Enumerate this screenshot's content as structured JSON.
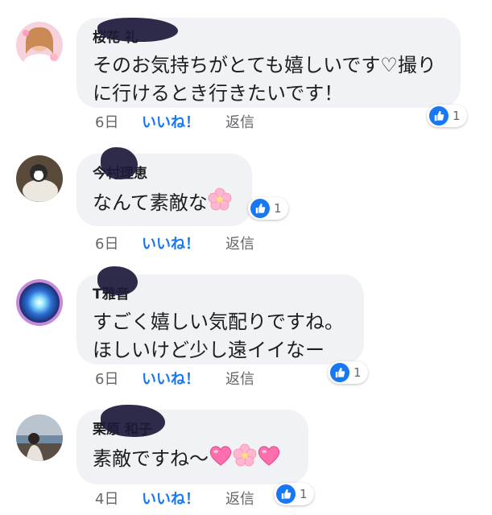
{
  "comments": [
    {
      "name": "桜花 礼",
      "text_lines": [
        "そのお気持ちがとても嬉しいです♡撮り",
        "に行けるとき行きたいです！"
      ],
      "time": "6日",
      "like_label": "いいね！",
      "reply_label": "返信",
      "reaction_count": "1"
    },
    {
      "name": "今村理恵",
      "text_lines": [
        "なんて素敵な"
      ],
      "time": "6日",
      "like_label": "いいね！",
      "reply_label": "返信",
      "reaction_count": "1"
    },
    {
      "name": "T雅音",
      "text_lines": [
        "すごく嬉しい気配りですね。",
        "ほしいけど少し遠イイなー"
      ],
      "time": "6日",
      "like_label": "いいね！",
      "reply_label": "返信",
      "reaction_count": "1"
    },
    {
      "name": "栗原 和子",
      "text_lines": [
        "素敵ですね〜"
      ],
      "time": "4日",
      "like_label": "いいね！",
      "reply_label": "返信",
      "reaction_count": "1"
    }
  ],
  "colors": {
    "bubble": "#f0f2f5",
    "link_blue": "#1877f2",
    "meta_gray": "#65676b",
    "text": "#1c1e21"
  },
  "icons": [
    "like-thumb-icon",
    "cherry-blossom-emoji-icon",
    "pink-heart-emoji-icon"
  ]
}
